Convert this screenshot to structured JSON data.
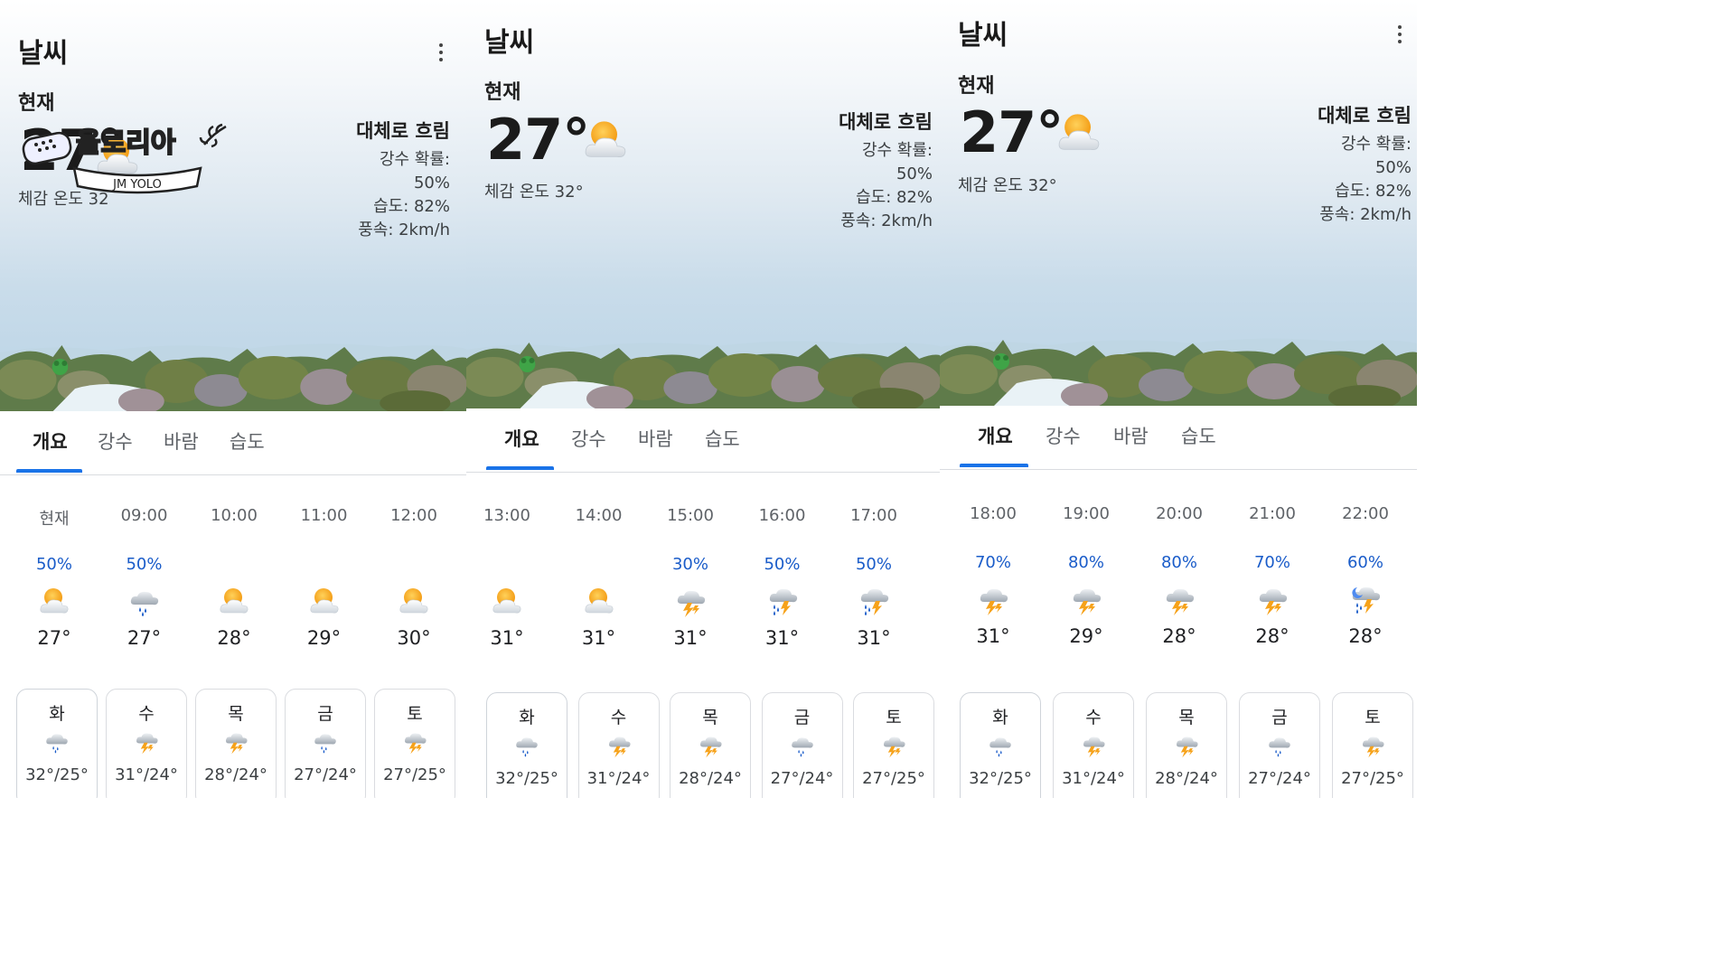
{
  "panels": [
    {
      "title": "날씨",
      "now_label": "현재",
      "temp": "27°",
      "feels": "체감 온도 32",
      "condition": "대체로 흐림",
      "details": [
        "강수 확률: 50%",
        "습도: 82%",
        "풍속: 2km/h"
      ],
      "tabs": [
        "개요",
        "강수",
        "바람",
        "습도"
      ],
      "hours": [
        {
          "time": "현재",
          "pop": "50%",
          "icon": "partly-cloudy-icon",
          "temp": "27°"
        },
        {
          "time": "09:00",
          "pop": "50%",
          "icon": "rain-cloud-icon",
          "temp": "27°"
        },
        {
          "time": "10:00",
          "pop": "",
          "icon": "partly-cloudy-icon",
          "temp": "28°"
        },
        {
          "time": "11:00",
          "pop": "",
          "icon": "partly-cloudy-icon",
          "temp": "29°"
        },
        {
          "time": "12:00",
          "pop": "",
          "icon": "partly-cloudy-icon",
          "temp": "30°"
        }
      ],
      "days": [
        {
          "name": "화",
          "icon": "rain-cloud-icon",
          "range": "32°/25°"
        },
        {
          "name": "수",
          "icon": "thunderstorm-icon",
          "range": "31°/24°"
        },
        {
          "name": "목",
          "icon": "thunderstorm-icon",
          "range": "28°/24°"
        },
        {
          "name": "금",
          "icon": "rain-cloud-icon",
          "range": "27°/24°"
        },
        {
          "name": "토",
          "icon": "thunderstorm-icon",
          "range": "27°/25°"
        }
      ],
      "sticker": {
        "main": "욜로리아",
        "sub": "JM YOLO"
      }
    },
    {
      "title": "날씨",
      "now_label": "현재",
      "temp": "27°",
      "feels": "체감 온도 32°",
      "condition": "대체로 흐림",
      "details": [
        "강수 확률: 50%",
        "습도: 82%",
        "풍속: 2km/h"
      ],
      "tabs": [
        "개요",
        "강수",
        "바람",
        "습도"
      ],
      "hours": [
        {
          "time": "13:00",
          "pop": "",
          "icon": "partly-cloudy-icon",
          "temp": "31°"
        },
        {
          "time": "14:00",
          "pop": "",
          "icon": "partly-cloudy-icon",
          "temp": "31°"
        },
        {
          "time": "15:00",
          "pop": "30%",
          "icon": "thunderstorm-icon",
          "temp": "31°"
        },
        {
          "time": "16:00",
          "pop": "50%",
          "icon": "thunder-rain-icon",
          "temp": "31°"
        },
        {
          "time": "17:00",
          "pop": "50%",
          "icon": "thunder-rain-icon",
          "temp": "31°"
        }
      ],
      "days": [
        {
          "name": "화",
          "icon": "rain-cloud-icon",
          "range": "32°/25°"
        },
        {
          "name": "수",
          "icon": "thunderstorm-icon",
          "range": "31°/24°"
        },
        {
          "name": "목",
          "icon": "thunderstorm-icon",
          "range": "28°/24°"
        },
        {
          "name": "금",
          "icon": "rain-cloud-icon",
          "range": "27°/24°"
        },
        {
          "name": "토",
          "icon": "thunderstorm-icon",
          "range": "27°/25°"
        }
      ]
    },
    {
      "title": "날씨",
      "now_label": "현재",
      "temp": "27°",
      "feels": "체감 온도 32°",
      "condition": "대체로 흐림",
      "details": [
        "강수 확률: 50%",
        "습도: 82%",
        "풍속: 2km/h"
      ],
      "tabs": [
        "개요",
        "강수",
        "바람",
        "습도"
      ],
      "hours": [
        {
          "time": "18:00",
          "pop": "70%",
          "icon": "thunderstorm-icon",
          "temp": "31°"
        },
        {
          "time": "19:00",
          "pop": "80%",
          "icon": "thunderstorm-icon",
          "temp": "29°"
        },
        {
          "time": "20:00",
          "pop": "80%",
          "icon": "thunderstorm-icon",
          "temp": "28°"
        },
        {
          "time": "21:00",
          "pop": "70%",
          "icon": "thunderstorm-icon",
          "temp": "28°"
        },
        {
          "time": "22:00",
          "pop": "60%",
          "icon": "thunder-rain-night-icon",
          "temp": "28°"
        }
      ],
      "days": [
        {
          "name": "화",
          "icon": "rain-cloud-icon",
          "range": "32°/25°"
        },
        {
          "name": "수",
          "icon": "thunderstorm-icon",
          "range": "31°/24°"
        },
        {
          "name": "목",
          "icon": "thunderstorm-icon",
          "range": "28°/24°"
        },
        {
          "name": "금",
          "icon": "rain-cloud-icon",
          "range": "27°/24°"
        },
        {
          "name": "토",
          "icon": "thunderstorm-icon",
          "range": "27°/25°"
        }
      ]
    }
  ],
  "colors": {
    "accent": "#1a73e8",
    "pop_text": "#1a5cc9",
    "sun": "#f6a21a",
    "cloud": "#e9ecef"
  }
}
